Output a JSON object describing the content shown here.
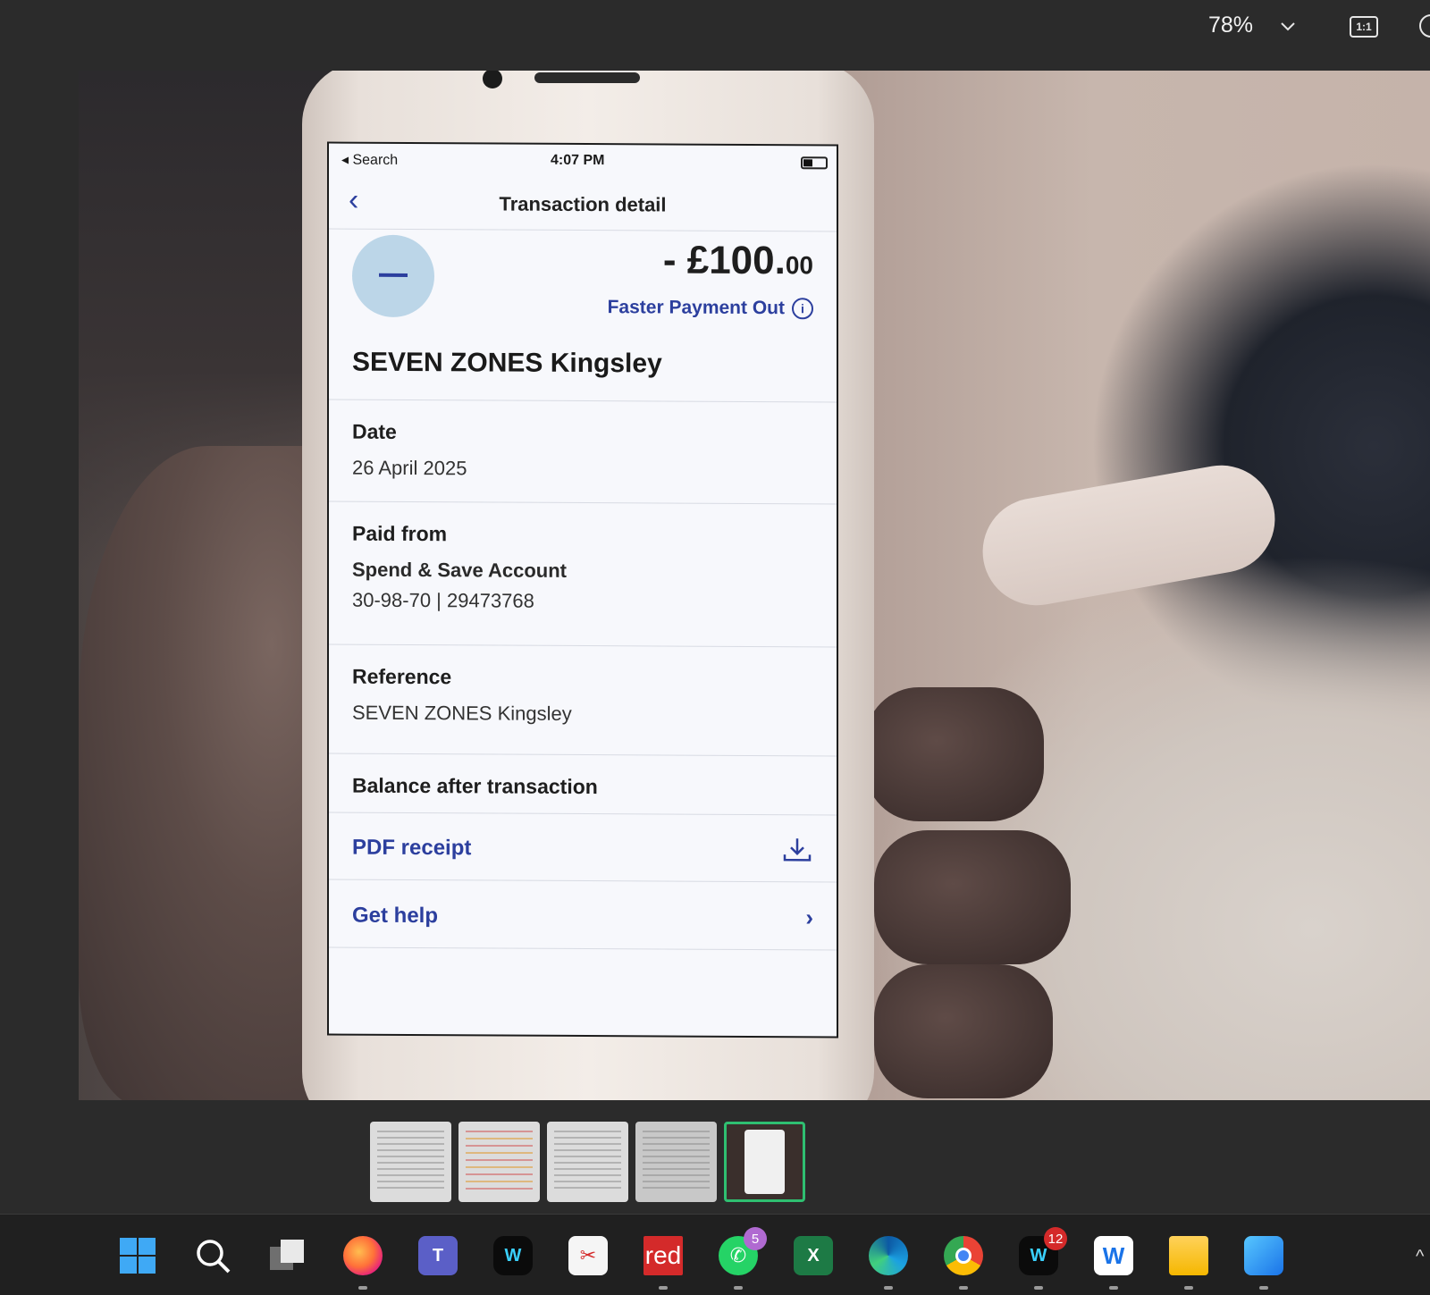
{
  "viewer": {
    "zoom": "78%",
    "one_to_one": "1:1"
  },
  "phone": {
    "status": {
      "back_label": "◂ Search",
      "time": "4:07 PM"
    },
    "nav": {
      "title": "Transaction detail"
    },
    "amount_main": "- £100.",
    "amount_pence": "00",
    "payment_type": "Faster Payment Out",
    "merchant": "SEVEN ZONES Kingsley",
    "date_label": "Date",
    "date_value": "26 April 2025",
    "paid_from_label": "Paid from",
    "account_name": "Spend & Save Account",
    "account_number": "30-98-70 | 29473768",
    "reference_label": "Reference",
    "reference_value": "SEVEN ZONES Kingsley",
    "balance_label": "Balance after transaction",
    "pdf_receipt": "PDF receipt",
    "get_help": "Get help"
  },
  "thumbnails": {
    "count": 5,
    "active_index": 4
  },
  "taskbar": {
    "icons": [
      "windows-start-icon",
      "search-icon",
      "task-view-icon",
      "firefox-icon",
      "teams-icon",
      "webex-icon",
      "snipping-tool-icon",
      "red-app-icon",
      "whatsapp-icon",
      "excel-icon",
      "edge-icon",
      "chrome-icon",
      "webex-badge-icon",
      "word-w-icon",
      "file-explorer-icon",
      "photos-icon"
    ],
    "red_label": "red",
    "whatsapp_badge": "5",
    "webex_badge": "12"
  }
}
